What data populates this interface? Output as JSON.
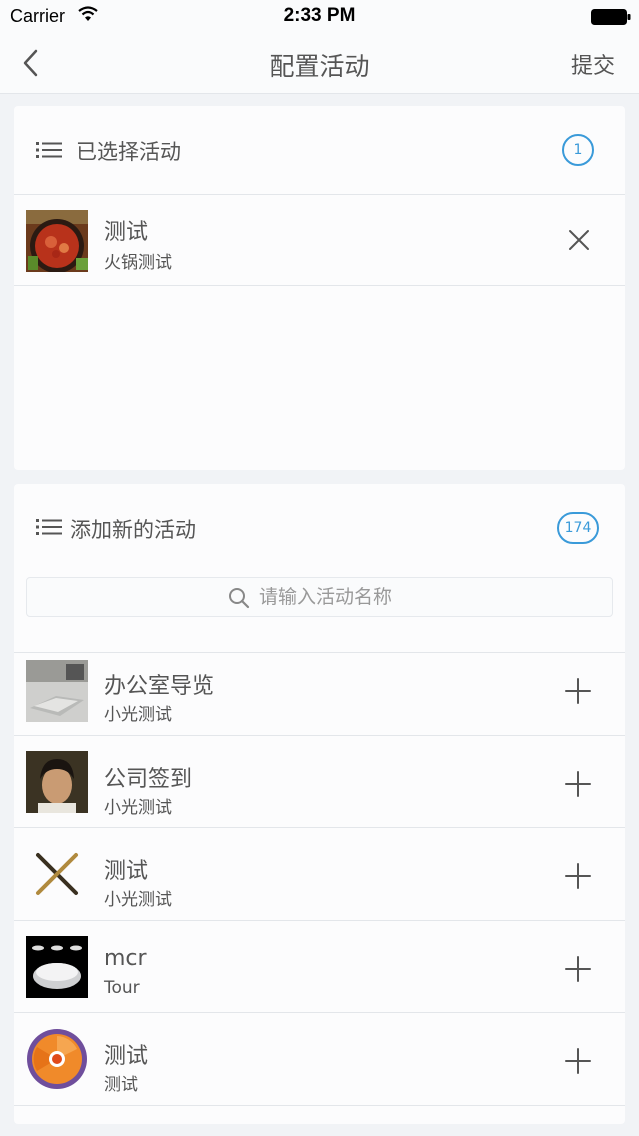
{
  "status_bar": {
    "carrier": "Carrier",
    "time": "2:33 PM"
  },
  "nav": {
    "title": "配置活动",
    "submit_label": "提交",
    "back_icon": "chevron-left-icon"
  },
  "selected_section": {
    "title": "已选择活动",
    "count": "1",
    "items": [
      {
        "title": "测试",
        "subtitle": "火锅测试",
        "action_icon": "close-icon"
      }
    ]
  },
  "add_section": {
    "title": "添加新的活动",
    "count": "174",
    "search_placeholder": "请输入活动名称",
    "items": [
      {
        "title": "办公室导览",
        "subtitle": "小光测试",
        "action_icon": "plus-icon"
      },
      {
        "title": "公司签到",
        "subtitle": "小光测试",
        "action_icon": "plus-icon"
      },
      {
        "title": "测试",
        "subtitle": "小光测试",
        "action_icon": "plus-icon"
      },
      {
        "title": "mcr",
        "subtitle": "Tour",
        "action_icon": "plus-icon"
      },
      {
        "title": "测试",
        "subtitle": "测试",
        "action_icon": "plus-icon"
      }
    ]
  },
  "colors": {
    "accent": "#3a9ad9",
    "background": "#f1f3f6",
    "card": "#fcfcfd",
    "text": "#555555"
  }
}
